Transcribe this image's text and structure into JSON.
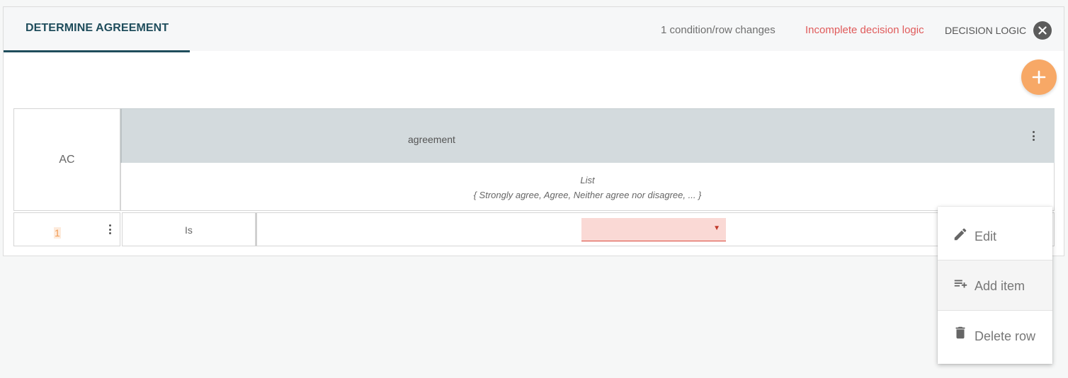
{
  "tab": {
    "label": "DETERMINE AGREEMENT"
  },
  "header": {
    "changes": "1 condition/row changes",
    "incomplete": "Incomplete decision logic",
    "logic_label": "DECISION LOGIC"
  },
  "table": {
    "row_header": "AC",
    "column": {
      "name": "agreement",
      "type": "List",
      "values": "{ Strongly agree, Agree, Neither agree nor disagree, ... }"
    },
    "rows": [
      {
        "number": "1",
        "operator": "Is",
        "value": ""
      }
    ]
  },
  "context_menu": {
    "items": [
      {
        "label": "Edit",
        "icon": "pencil-icon"
      },
      {
        "label": "Add item",
        "icon": "playlist-add-icon"
      },
      {
        "label": "Delete row",
        "icon": "trash-icon"
      }
    ]
  },
  "colors": {
    "accent": "#1f4d5c",
    "error": "#e05a5a",
    "fab": "#f7a866",
    "header_band": "#d3dadd"
  }
}
